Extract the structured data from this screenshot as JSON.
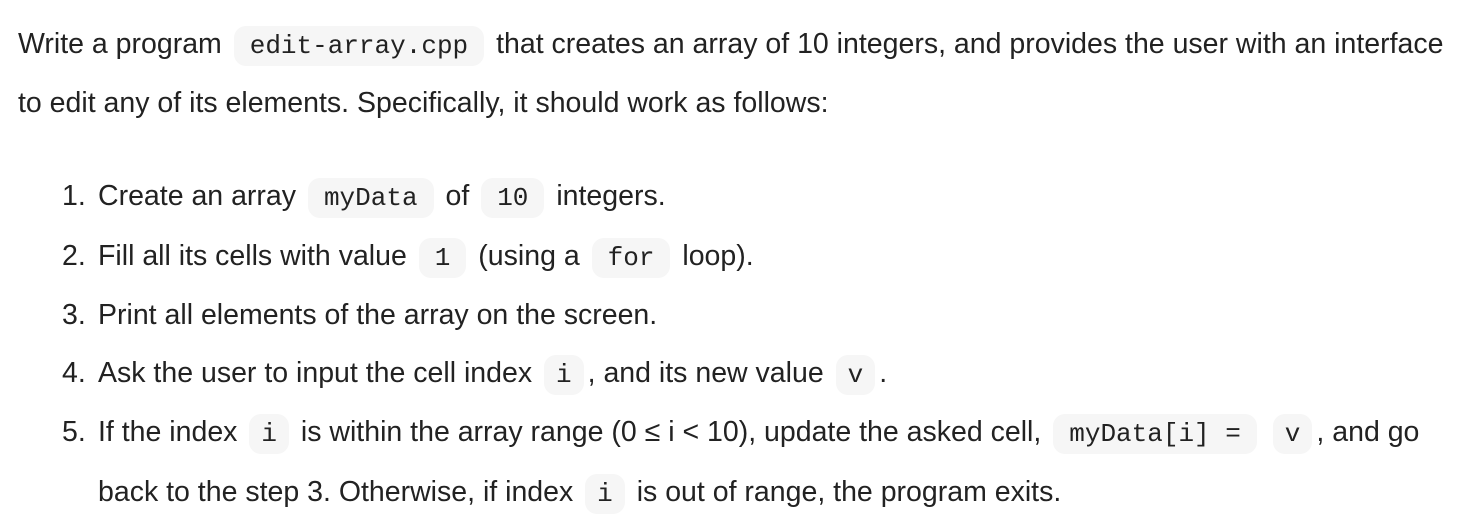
{
  "intro": {
    "text_before": "Write a program",
    "filename": "edit-array.cpp",
    "text_after": "that creates an array of 10 integers, and provides the user with an interface to edit any of its elements. Specifically, it should work as follows:"
  },
  "steps": [
    {
      "number": "1.",
      "parts": {
        "t1": "Create an array",
        "c1": "myData",
        "t2": "of",
        "c2": "10",
        "t3": "integers."
      }
    },
    {
      "number": "2.",
      "parts": {
        "t1": "Fill all its cells with value",
        "c1": "1",
        "t2": "(using a",
        "c2": "for",
        "t3": "loop)."
      }
    },
    {
      "number": "3.",
      "parts": {
        "t1": "Print all elements of the array on the screen."
      }
    },
    {
      "number": "4.",
      "parts": {
        "t1": "Ask the user to input the cell index",
        "c1": "i",
        "t2": ", and its new value",
        "c2": "v",
        "t3": "."
      }
    },
    {
      "number": "5.",
      "parts": {
        "t1": "If the index",
        "c1": "i",
        "t2": "is within the array range (0 ≤ i < 10), update the asked cell,",
        "c2": "myData[i] =",
        "c3": "v",
        "t3": ", and go back to the step 3. Otherwise, if index",
        "c4": "i",
        "t4": "is out of range, the program exits."
      }
    }
  ]
}
